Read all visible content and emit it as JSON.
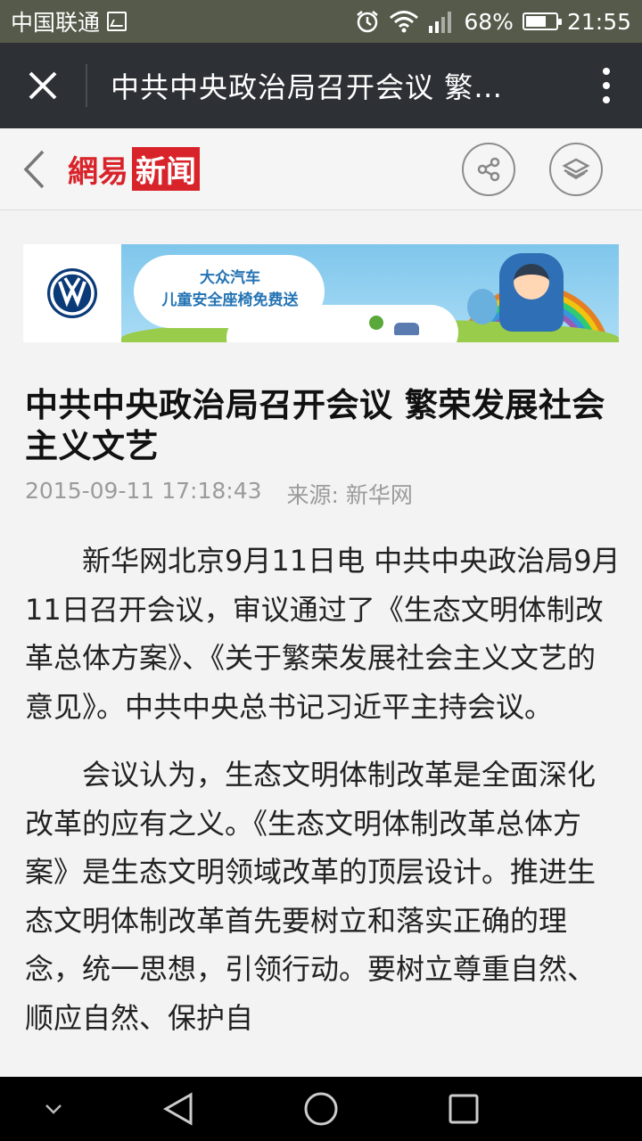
{
  "status_bar": {
    "carrier": "中国联通",
    "battery_percent_label": "68%",
    "battery_level": 0.68,
    "time": "21:55"
  },
  "title_bar": {
    "title": "中共中央政治局召开会议 繁…"
  },
  "site_header": {
    "logo_part1": "網易",
    "logo_part2": "新闻"
  },
  "ad": {
    "line1": "大众汽车",
    "line2": "儿童安全座椅免费送"
  },
  "article": {
    "title": "中共中央政治局召开会议 繁荣发展社会主义文艺",
    "datetime": "2015-09-11 17:18:43",
    "source": "来源: 新华网",
    "paragraphs": [
      "新华网北京9月11日电 中共中央政治局9月11日召开会议，审议通过了《生态文明体制改革总体方案》、《关于繁荣发展社会主义文艺的意见》。中共中央总书记习近平主持会议。",
      "会议认为，生态文明体制改革是全面深化改革的应有之义。《生态文明体制改革总体方案》是生态文明领域改革的顶层设计。推进生态文明体制改革首先要树立和落实正确的理念，统一思想，引领行动。要树立尊重自然、顺应自然、保护自"
    ]
  },
  "colors": {
    "brand_red": "#d8232a",
    "title_bar": "#2d3135",
    "status_bar": "#555a4a"
  }
}
